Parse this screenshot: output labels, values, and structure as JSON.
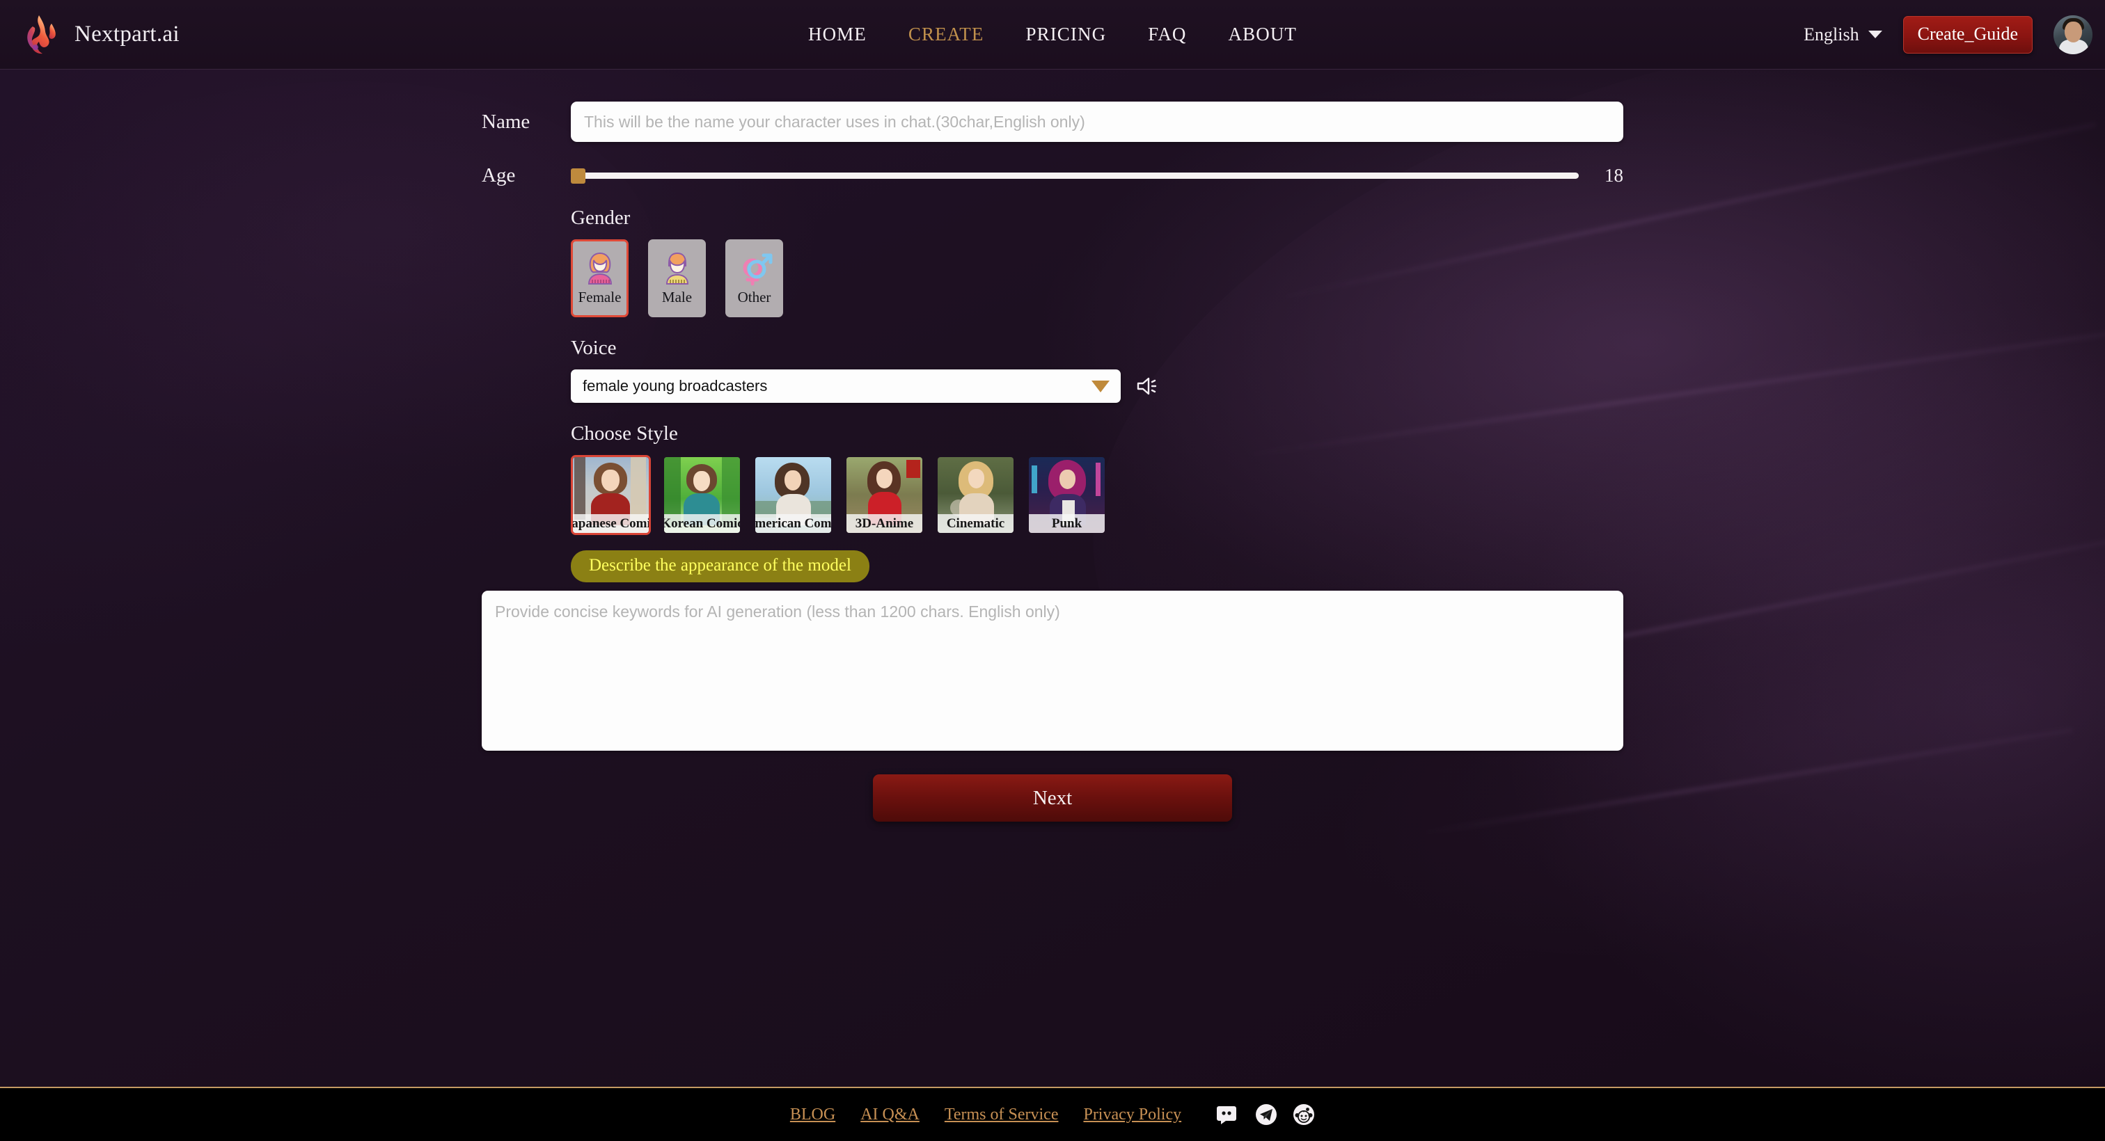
{
  "header": {
    "brand": "Nextpart.ai",
    "logo_icon": "flame-logo-icon",
    "nav": [
      {
        "label": "HOME",
        "active": false
      },
      {
        "label": "CREATE",
        "active": true
      },
      {
        "label": "PRICING",
        "active": false
      },
      {
        "label": "FAQ",
        "active": false
      },
      {
        "label": "ABOUT",
        "active": false
      }
    ],
    "language": "English",
    "language_caret_icon": "chevron-down-icon",
    "guide_button": "Create_Guide",
    "avatar_icon": "user-avatar",
    "accent_active": "#c0904c",
    "guide_button_color": "#8a1411"
  },
  "form": {
    "name": {
      "label": "Name",
      "value": "",
      "placeholder": "This will be the name your character uses in chat.(30char,English only)"
    },
    "age": {
      "label": "Age",
      "value": "18",
      "min": "18",
      "max": "80",
      "thumb_color": "#bf8a3d"
    },
    "gender": {
      "label": "Gender",
      "selected": "Female",
      "options": [
        {
          "label": "Female",
          "icon": "female-person-icon"
        },
        {
          "label": "Male",
          "icon": "male-person-icon"
        },
        {
          "label": "Other",
          "icon": "gender-symbols-icon"
        }
      ],
      "selected_border": "#e04a38"
    },
    "voice": {
      "label": "Voice",
      "value": "female young broadcasters",
      "caret_icon": "chevron-down-icon",
      "preview_icon": "speaker-icon"
    },
    "style": {
      "label": "Choose Style",
      "selected": "Japanese Comic",
      "options": [
        {
          "label": "Japanese Comic"
        },
        {
          "label": "Korean Comic"
        },
        {
          "label": "American Comic"
        },
        {
          "label": "3D-Anime"
        },
        {
          "label": "Cinematic"
        },
        {
          "label": "Punk"
        }
      ],
      "selected_border": "#d94436"
    },
    "description": {
      "badge": "Describe the appearance of the model",
      "badge_bg": "#8b8014",
      "badge_color": "#ffff5e",
      "value": "",
      "placeholder": "Provide concise keywords for AI generation (less than 1200 chars. English only)"
    },
    "next_button": "Next"
  },
  "footer": {
    "links": [
      "BLOG",
      "AI Q&A",
      "Terms of Service",
      "Privacy Policy"
    ],
    "social": [
      {
        "name": "discord-icon"
      },
      {
        "name": "telegram-icon"
      },
      {
        "name": "reddit-icon"
      }
    ],
    "link_color": "#c79054",
    "border_color": "#c49a63"
  }
}
